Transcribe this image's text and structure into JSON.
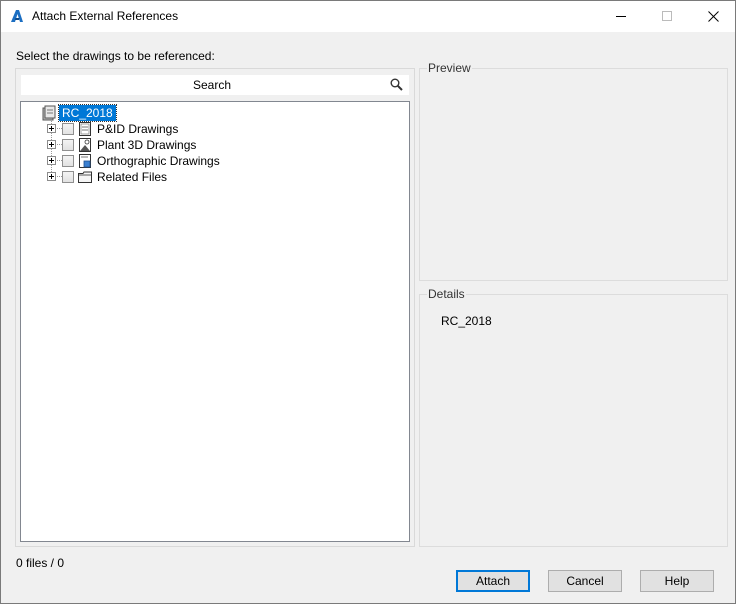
{
  "window": {
    "title": "Attach External References",
    "app_icon": "autocad-a-logo-icon"
  },
  "left": {
    "instruction": "Select the drawings to be referenced:",
    "search": {
      "placeholder": "Search",
      "icon": "search-icon"
    },
    "tree": {
      "root": {
        "label": "RC_2018",
        "icon": "project-icon",
        "selected": true
      },
      "children": [
        {
          "label": "P&ID Drawings",
          "icon": "pid-drawing-icon",
          "checked": false,
          "expanded": false
        },
        {
          "label": "Plant 3D Drawings",
          "icon": "plant3d-drawing-icon",
          "checked": false,
          "expanded": false
        },
        {
          "label": "Orthographic Drawings",
          "icon": "ortho-drawing-icon",
          "checked": false,
          "expanded": false
        },
        {
          "label": "Related Files",
          "icon": "folder-icon",
          "checked": false,
          "expanded": false
        }
      ]
    }
  },
  "preview": {
    "label": "Preview"
  },
  "details": {
    "label": "Details",
    "value": "RC_2018"
  },
  "status": {
    "text": "0 files / 0"
  },
  "buttons": {
    "attach": "Attach",
    "cancel": "Cancel",
    "help": "Help"
  },
  "colors": {
    "selection": "#0078d7",
    "background": "#f0f0f0",
    "app_icon": "#1b6ec2"
  }
}
